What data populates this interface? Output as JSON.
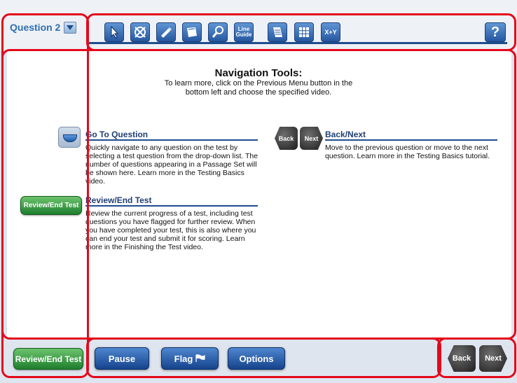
{
  "header": {
    "question_label": "Question 2",
    "tools": [
      {
        "icon": "pointer-icon"
      },
      {
        "icon": "eliminator-icon"
      },
      {
        "icon": "highlighter-icon"
      },
      {
        "icon": "sticky-note-icon"
      },
      {
        "icon": "magnifier-icon"
      },
      {
        "icon": "line-guide-icon",
        "label": "Line Guide"
      },
      {
        "icon": "notepad-icon"
      },
      {
        "icon": "grid-icon"
      },
      {
        "icon": "formula-icon",
        "label": "X+Y"
      }
    ],
    "help_label": "?"
  },
  "main": {
    "title": "Navigation Tools:",
    "subtitle": "To learn more, click on the Previous Menu button in the bottom left and choose the specified video.",
    "sections": {
      "goto": {
        "title": "Go To Question",
        "body": "Quickly navigate to any question on the test by selecting a test question from the drop-down list. The number of questions appearing in a Passage Set will be shown here. Learn more in the Testing Basics video."
      },
      "backnext": {
        "title": "Back/Next",
        "body": "Move to the previous question or move to the next question. Learn more in the Testing Basics tutorial.",
        "back_label": "Back",
        "next_label": "Next"
      },
      "review": {
        "title": "Review/End Test",
        "body": "Review the current progress of a test, including test questions you have flagged for further review. When you have completed your test, this is also where you can end your test and submit it for scoring. Learn more in the Finishing the Test video.",
        "button_label": "Review/End Test"
      }
    }
  },
  "footer": {
    "review_label": "Review/End Test",
    "pause_label": "Pause",
    "flag_label": "Flag",
    "options_label": "Options",
    "back_label": "Back",
    "next_label": "Next"
  },
  "colors": {
    "highlight_red": "#e3091b",
    "brand_blue": "#1f4d8f",
    "review_green": "#1e7f2e"
  }
}
